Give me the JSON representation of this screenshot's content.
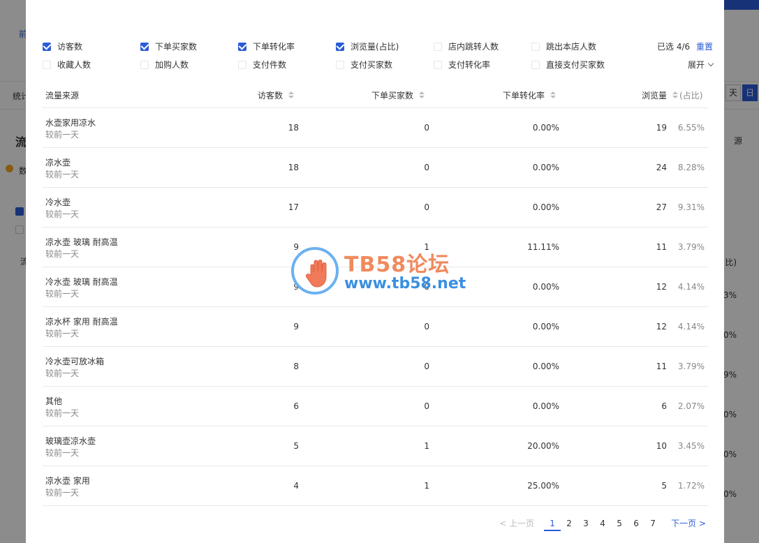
{
  "background": {
    "left_labels": [
      "前",
      "统计",
      "流",
      "数",
      "流"
    ],
    "right_labels": [
      "源",
      "比)",
      "3%",
      "0%",
      "9%",
      "0%",
      "0%",
      "0%"
    ],
    "day_button": "日",
    "day_button_alt": "天"
  },
  "filters": {
    "row1": [
      {
        "label": "访客数",
        "checked": true
      },
      {
        "label": "下单买家数",
        "checked": true
      },
      {
        "label": "下单转化率",
        "checked": true
      },
      {
        "label": "浏览量(占比)",
        "checked": true
      },
      {
        "label": "店内跳转人数",
        "checked": false
      },
      {
        "label": "跳出本店人数",
        "checked": false
      }
    ],
    "row2": [
      {
        "label": "收藏人数",
        "checked": false
      },
      {
        "label": "加购人数",
        "checked": false
      },
      {
        "label": "支付件数",
        "checked": false
      },
      {
        "label": "支付买家数",
        "checked": false
      },
      {
        "label": "支付转化率",
        "checked": false
      },
      {
        "label": "直接支付买家数",
        "checked": false
      }
    ],
    "selected_text": "已选 4/6",
    "reset_label": "重置",
    "expand_label": "展开"
  },
  "table": {
    "headers": [
      "流量来源",
      "访客数",
      "下单买家数",
      "下单转化率",
      "浏览量",
      "(占比)"
    ],
    "rows": [
      {
        "source": "水壶家用凉水",
        "compare": "较前一天",
        "visitors": "18",
        "buyers": "0",
        "conversion": "0.00%",
        "pageviews": "19",
        "share": "6.55%"
      },
      {
        "source": "凉水壶",
        "compare": "较前一天",
        "visitors": "18",
        "buyers": "0",
        "conversion": "0.00%",
        "pageviews": "24",
        "share": "8.28%"
      },
      {
        "source": "冷水壶",
        "compare": "较前一天",
        "visitors": "17",
        "buyers": "0",
        "conversion": "0.00%",
        "pageviews": "27",
        "share": "9.31%"
      },
      {
        "source": "凉水壶 玻璃 耐高温",
        "compare": "较前一天",
        "visitors": "9",
        "buyers": "1",
        "conversion": "11.11%",
        "pageviews": "11",
        "share": "3.79%"
      },
      {
        "source": "冷水壶 玻璃 耐高温",
        "compare": "较前一天",
        "visitors": "9",
        "buyers": "0",
        "conversion": "0.00%",
        "pageviews": "12",
        "share": "4.14%"
      },
      {
        "source": "凉水杯 家用 耐高温",
        "compare": "较前一天",
        "visitors": "9",
        "buyers": "0",
        "conversion": "0.00%",
        "pageviews": "12",
        "share": "4.14%"
      },
      {
        "source": "冷水壶可放冰箱",
        "compare": "较前一天",
        "visitors": "8",
        "buyers": "0",
        "conversion": "0.00%",
        "pageviews": "11",
        "share": "3.79%"
      },
      {
        "source": "其他",
        "compare": "较前一天",
        "visitors": "6",
        "buyers": "0",
        "conversion": "0.00%",
        "pageviews": "6",
        "share": "2.07%"
      },
      {
        "source": "玻璃壶凉水壶",
        "compare": "较前一天",
        "visitors": "5",
        "buyers": "1",
        "conversion": "20.00%",
        "pageviews": "10",
        "share": "3.45%"
      },
      {
        "source": "凉水壶 家用",
        "compare": "较前一天",
        "visitors": "4",
        "buyers": "1",
        "conversion": "25.00%",
        "pageviews": "5",
        "share": "1.72%"
      }
    ]
  },
  "pagination": {
    "prev_label": "< 上一页",
    "pages": [
      "1",
      "2",
      "3",
      "4",
      "5",
      "6",
      "7"
    ],
    "current": "1",
    "next_label": "下一页 >"
  },
  "watermark": {
    "title": "TB58论坛",
    "url": "www.tb58.net"
  },
  "colors": {
    "accent": "#2a5bd7",
    "watermark_orange": "#f08a5d",
    "watermark_blue": "#3b8fe0"
  }
}
